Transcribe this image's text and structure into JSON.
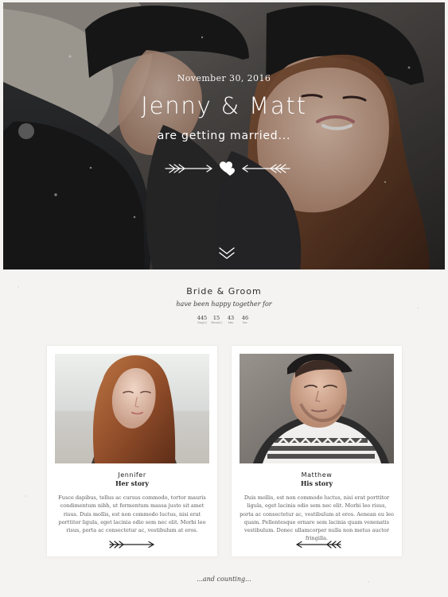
{
  "hero": {
    "date": "November 30, 2016",
    "title": "Jenny & Matt",
    "subtitle": "are getting married..."
  },
  "section": {
    "title": "Bride & Groom",
    "subtitle": "have been happy together for"
  },
  "countdown": [
    {
      "value": "445",
      "label": "Day(s)"
    },
    {
      "value": "15",
      "label": "Hour(s)"
    },
    {
      "value": "43",
      "label": "Min"
    },
    {
      "value": "46",
      "label": "Sec"
    }
  ],
  "profiles": [
    {
      "name": "Jennifer",
      "story": "Her story",
      "text": "Fusce dapibus, tellus ac cursus commodo, tortor mauris condimentum nibh, ut fermentum massa justo sit amet risus. Duis mollis, est non commodo luctus, nisi erat porttitor ligula, eget lacinia odio sem nec elit. Morbi leo risus, porta ac consectetur ac, vestibulum at eros."
    },
    {
      "name": "Matthew",
      "story": "His story",
      "text": "Duis mollis, est non commodo luctus, nisi erat porttitor ligula, eget lacinia odio sem nec elit. Morbi leo risus, porta ac consectetur ac, vestibulum at eros. Aenean eu leo quam. Pellentesque ornare sem lacinia quam venenatis vestibulum. Donec ullamcorper nulla non metus auctor fringilla."
    }
  ],
  "footer": {
    "text": "...and counting..."
  },
  "icons": {
    "scroll_down": "chevron-down-icon",
    "hearts": "double-heart-icon",
    "arrow_right": "arrow-right-icon",
    "arrow_left": "arrow-left-icon"
  }
}
